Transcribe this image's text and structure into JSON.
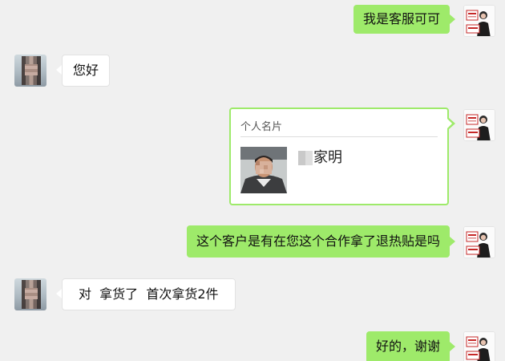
{
  "messages": [
    {
      "side": "self",
      "text": "我是客服可可"
    },
    {
      "side": "other",
      "text": "您好"
    },
    {
      "side": "self",
      "type": "contact_card",
      "card_header": "个人名片",
      "card_name": "家明"
    },
    {
      "side": "self",
      "text": "这个客户是有在您这个合作拿了退热贴是吗"
    },
    {
      "side": "other",
      "text": "对  拿货了  首次拿货2件"
    },
    {
      "side": "self",
      "text": "好的，谢谢"
    }
  ],
  "colors": {
    "background": "#f0f0f0",
    "self_bubble": "#9eea6a",
    "other_bubble": "#ffffff"
  }
}
